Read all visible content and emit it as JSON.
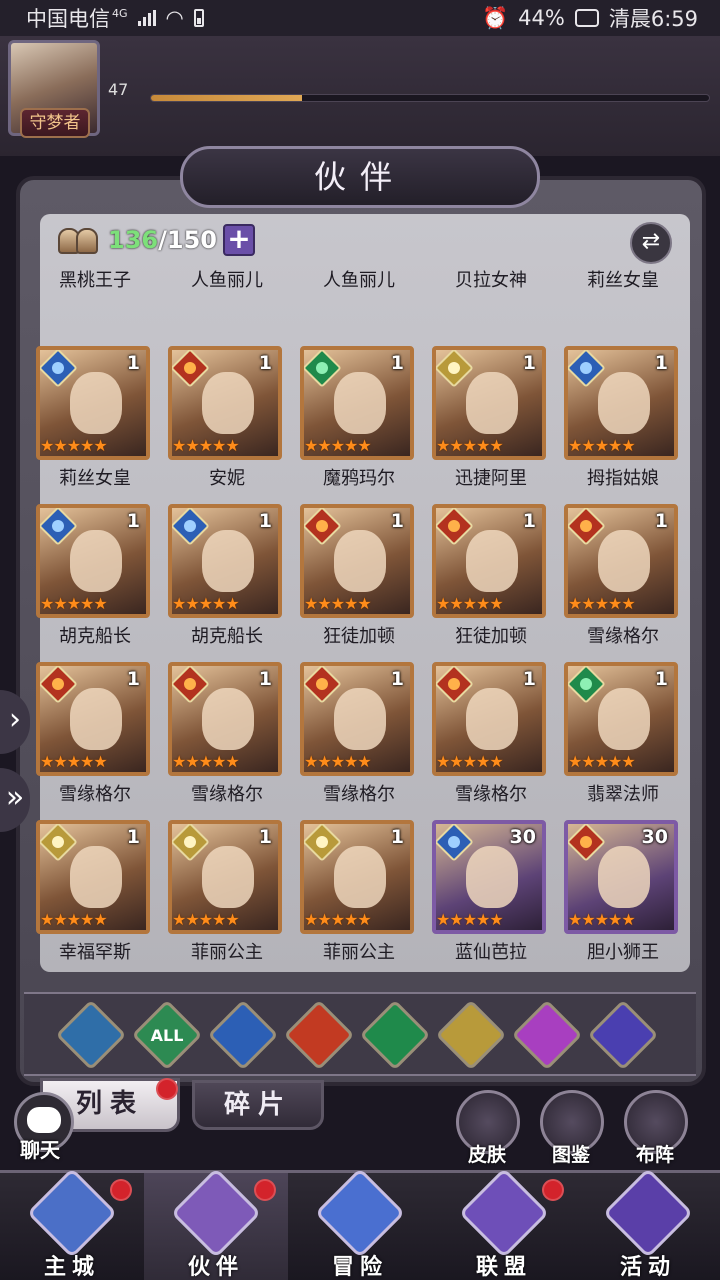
{
  "statusbar": {
    "carrier": "中国电信",
    "network": "4G",
    "battery": "44%",
    "time": "清晨6:59"
  },
  "player": {
    "level": "47",
    "title": "守梦者",
    "xp_fraction": 0.27
  },
  "panel": {
    "title": "伙伴",
    "count_current": "136",
    "count_total": "/150",
    "add_label": "+",
    "swap_label": "⇄"
  },
  "cards": [
    {
      "name": "黑桃王子",
      "element": "none",
      "level": "",
      "frame": "gold"
    },
    {
      "name": "人鱼丽儿",
      "element": "none",
      "level": "",
      "frame": "gold"
    },
    {
      "name": "人鱼丽儿",
      "element": "none",
      "level": "",
      "frame": "gold"
    },
    {
      "name": "贝拉女神",
      "element": "none",
      "level": "",
      "frame": "gold"
    },
    {
      "name": "莉丝女皇",
      "element": "none",
      "level": "",
      "frame": "gold"
    },
    {
      "name": "莉丝女皇",
      "element": "water",
      "level": "1",
      "frame": "gold"
    },
    {
      "name": "安妮",
      "element": "fire",
      "level": "1",
      "frame": "gold"
    },
    {
      "name": "魔鸦玛尔",
      "element": "wind",
      "level": "1",
      "frame": "gold"
    },
    {
      "name": "迅捷阿里",
      "element": "light",
      "level": "1",
      "frame": "gold"
    },
    {
      "name": "拇指姑娘",
      "element": "water",
      "level": "1",
      "frame": "gold"
    },
    {
      "name": "胡克船长",
      "element": "water",
      "level": "1",
      "frame": "gold"
    },
    {
      "name": "胡克船长",
      "element": "water",
      "level": "1",
      "frame": "gold"
    },
    {
      "name": "狂徒加顿",
      "element": "fire",
      "level": "1",
      "frame": "gold"
    },
    {
      "name": "狂徒加顿",
      "element": "fire",
      "level": "1",
      "frame": "gold"
    },
    {
      "name": "雪缘格尔",
      "element": "fire",
      "level": "1",
      "frame": "gold"
    },
    {
      "name": "雪缘格尔",
      "element": "fire",
      "level": "1",
      "frame": "gold"
    },
    {
      "name": "雪缘格尔",
      "element": "fire",
      "level": "1",
      "frame": "gold"
    },
    {
      "name": "雪缘格尔",
      "element": "fire",
      "level": "1",
      "frame": "gold"
    },
    {
      "name": "雪缘格尔",
      "element": "fire",
      "level": "1",
      "frame": "gold"
    },
    {
      "name": "翡翠法师",
      "element": "wind",
      "level": "1",
      "frame": "gold"
    },
    {
      "name": "幸福罕斯",
      "element": "light",
      "level": "1",
      "frame": "gold"
    },
    {
      "name": "菲丽公主",
      "element": "light",
      "level": "1",
      "frame": "gold"
    },
    {
      "name": "菲丽公主",
      "element": "light",
      "level": "1",
      "frame": "gold"
    },
    {
      "name": "蓝仙芭拉",
      "element": "water",
      "level": "30",
      "frame": "purple"
    },
    {
      "name": "胆小狮王",
      "element": "fire",
      "level": "30",
      "frame": "purple"
    }
  ],
  "stars": "★★★★★",
  "filters": [
    {
      "name": "filter-all-faction",
      "label": "",
      "color": "#2f6ea8"
    },
    {
      "name": "filter-all",
      "label": "ALL",
      "color": "#2d8a52"
    },
    {
      "name": "filter-water",
      "label": "",
      "color": "#2c5fb5"
    },
    {
      "name": "filter-fire",
      "label": "",
      "color": "#c23a22"
    },
    {
      "name": "filter-wind",
      "label": "",
      "color": "#1f8a4b"
    },
    {
      "name": "filter-light",
      "label": "",
      "color": "#b89a3a"
    },
    {
      "name": "filter-dark",
      "label": "",
      "color": "#a83fc0"
    },
    {
      "name": "filter-planet",
      "label": "",
      "color": "#4a3fb0"
    }
  ],
  "tabs": {
    "list": "列表",
    "fragments": "碎片"
  },
  "chat": {
    "label": "聊天"
  },
  "side": {
    "skin": "皮肤",
    "codex": "图鉴",
    "formation": "布阵"
  },
  "nav": [
    {
      "label": "主城",
      "color": "#4b6fc7"
    },
    {
      "label": "伙伴",
      "color": "#7e5ab8"
    },
    {
      "label": "冒险",
      "color": "#4a6fd0"
    },
    {
      "label": "联盟",
      "color": "#6e4fb8"
    },
    {
      "label": "活动",
      "color": "#5a3fa8"
    }
  ]
}
